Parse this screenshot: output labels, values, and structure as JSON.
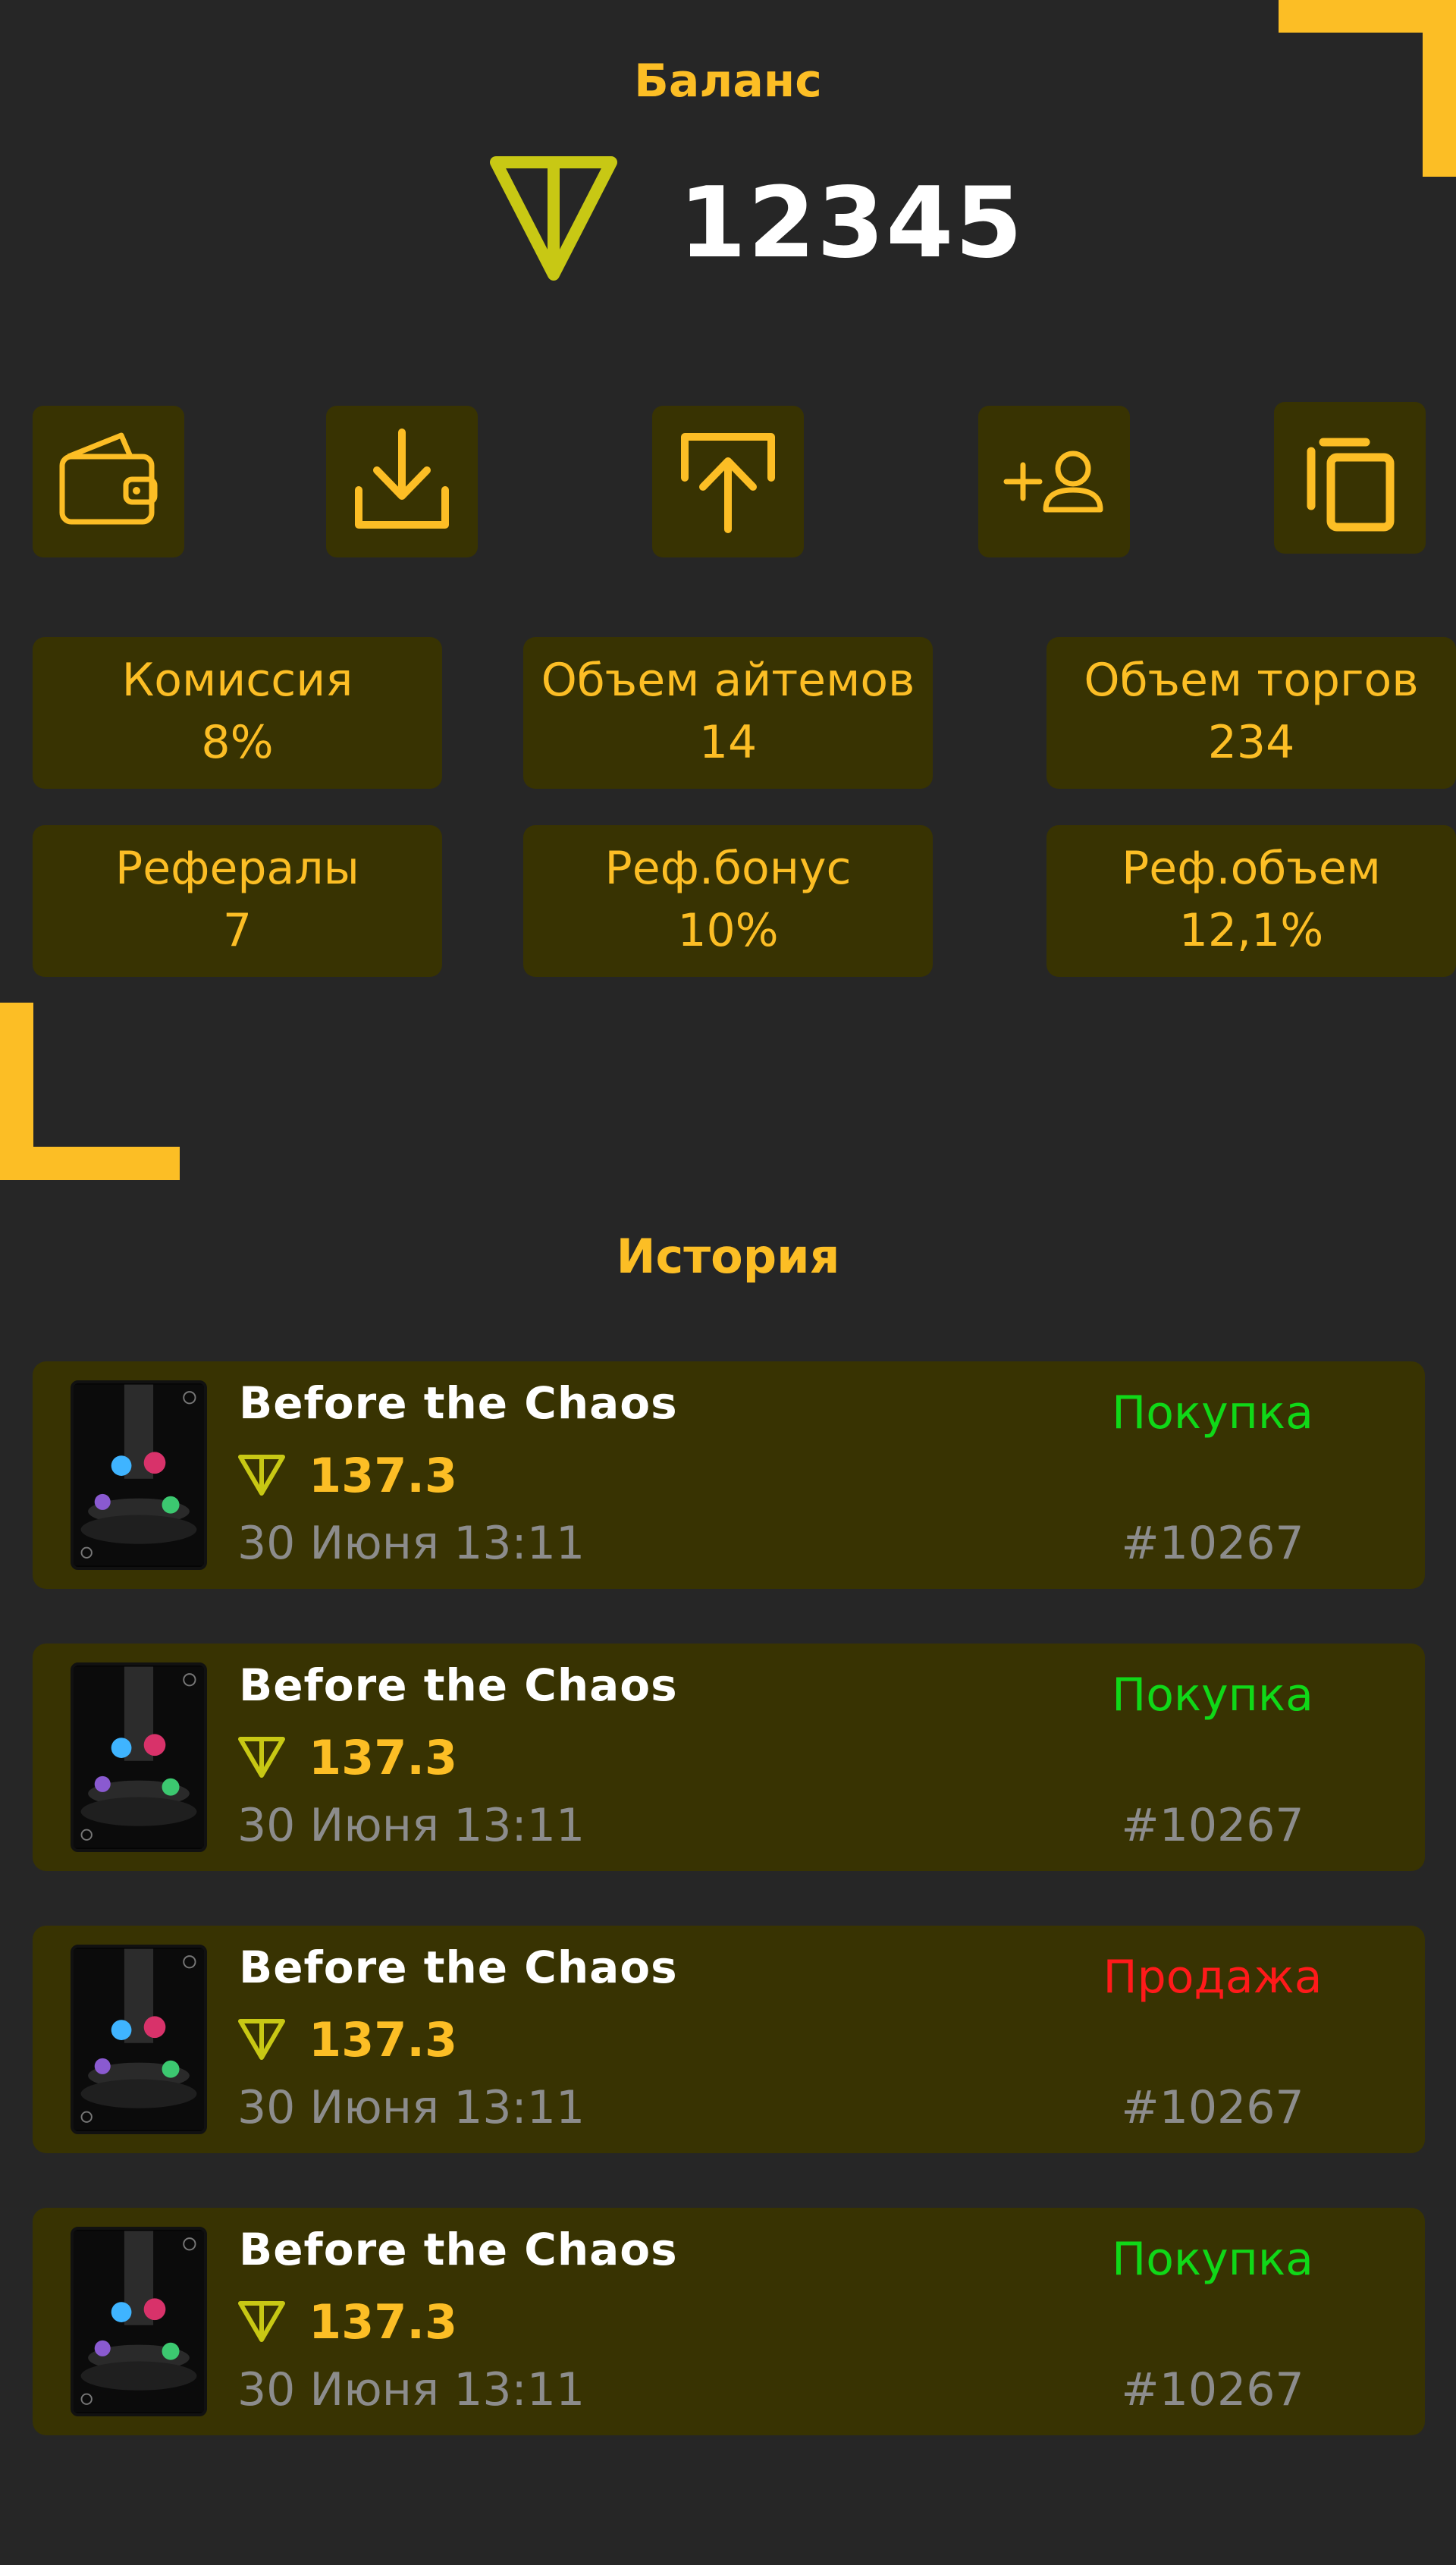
{
  "balance": {
    "title": "Баланс",
    "value": "12345",
    "currency_icon": "ton-icon"
  },
  "actions": [
    {
      "name": "wallet",
      "icon": "wallet-icon"
    },
    {
      "name": "deposit",
      "icon": "download-icon"
    },
    {
      "name": "withdraw",
      "icon": "upload-icon"
    },
    {
      "name": "invite",
      "icon": "add-user-icon"
    },
    {
      "name": "copy",
      "icon": "copy-icon"
    }
  ],
  "stats": {
    "commission": {
      "label": "Комиссия",
      "value": "8%"
    },
    "items_volume": {
      "label": "Объем айтемов",
      "value": "14"
    },
    "trade_volume": {
      "label": "Объем торгов",
      "value": "234"
    },
    "referrals": {
      "label": "Рефералы",
      "value": "7"
    },
    "ref_bonus": {
      "label": "Реф.бонус",
      "value": "10%"
    },
    "ref_volume": {
      "label": "Реф.объем",
      "value": "12,1%"
    }
  },
  "history": {
    "title": "История",
    "items": [
      {
        "title": "Before the Chaos",
        "price": "137.3",
        "date": "30 Июня 13:11",
        "type": "Покупка",
        "id": "#10267"
      },
      {
        "title": "Before the Chaos",
        "price": "137.3",
        "date": "30 Июня 13:11",
        "type": "Покупка",
        "id": "#10267"
      },
      {
        "title": "Before the Chaos",
        "price": "137.3",
        "date": "30 Июня 13:11",
        "type": "Продажа",
        "id": "#10267"
      },
      {
        "title": "Before the Chaos",
        "price": "137.3",
        "date": "30 Июня 13:11",
        "type": "Покупка",
        "id": "#10267"
      }
    ]
  },
  "colors": {
    "background": "#262626",
    "accent": "#fcbe25",
    "card": "#383302",
    "ton": "#c8c814",
    "buy": "#10d818",
    "sell": "#ff1a1a",
    "muted": "#8c8c8c"
  }
}
